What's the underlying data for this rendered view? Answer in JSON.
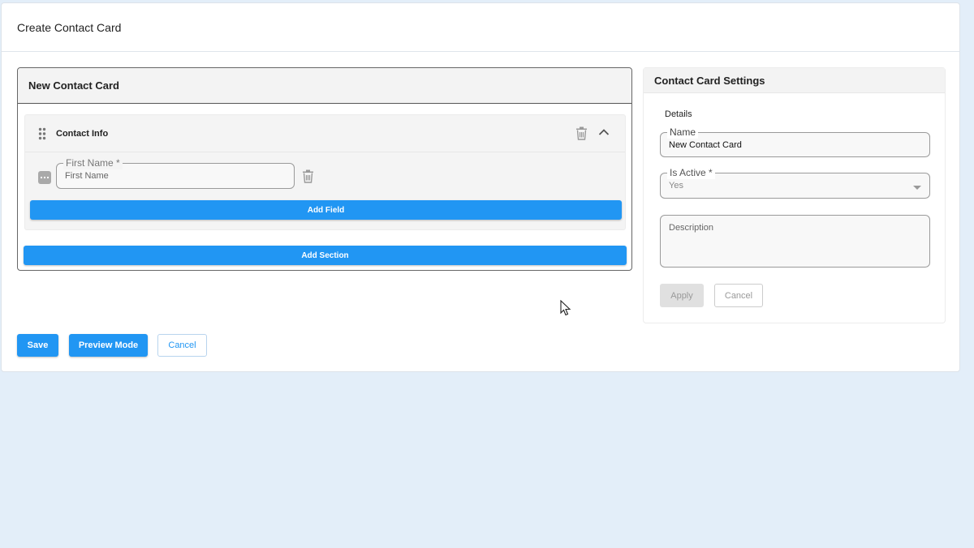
{
  "page": {
    "title": "Create Contact Card"
  },
  "builder": {
    "card_title": "New Contact Card",
    "section": {
      "title": "Contact Info",
      "field": {
        "label": "First Name *",
        "placeholder": "First Name"
      },
      "add_field_label": "Add Field"
    },
    "add_section_label": "Add Section"
  },
  "settings": {
    "title": "Contact Card Settings",
    "details_label": "Details",
    "name": {
      "label": "Name",
      "value": "New Contact Card"
    },
    "is_active": {
      "label": "Is Active *",
      "value": "Yes"
    },
    "description": {
      "placeholder": "Description"
    },
    "apply_label": "Apply",
    "cancel_label": "Cancel"
  },
  "footer": {
    "save_label": "Save",
    "preview_label": "Preview Mode",
    "cancel_label": "Cancel"
  },
  "colors": {
    "primary": "#2196f3",
    "background": "#e3eef9",
    "panel": "#ffffff"
  }
}
